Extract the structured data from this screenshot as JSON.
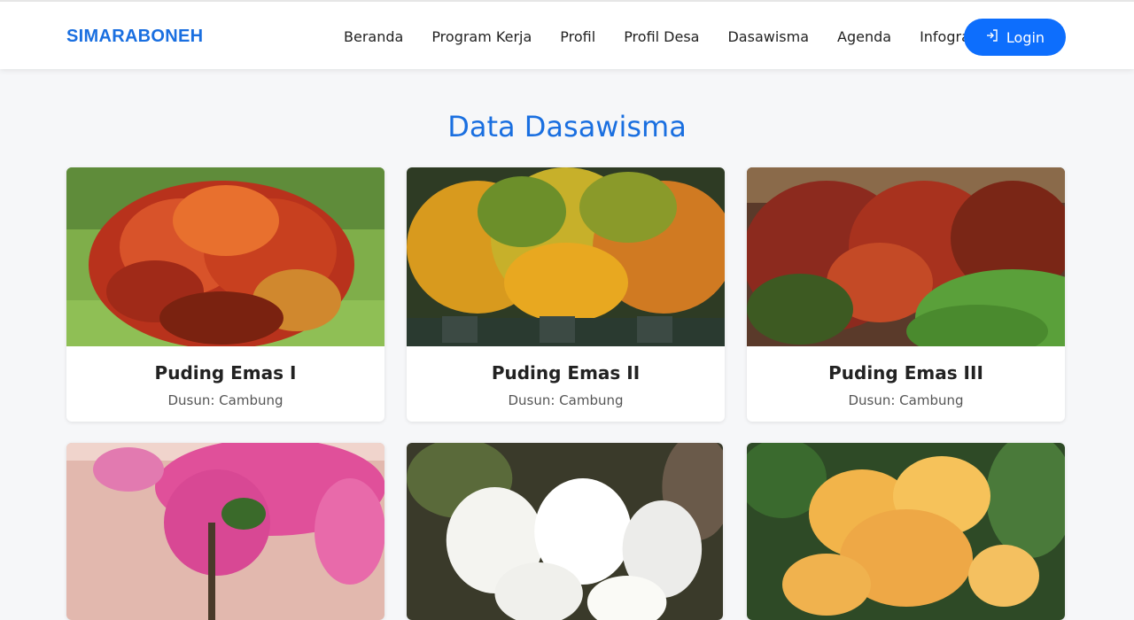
{
  "brand": "SIMARABONEH",
  "nav": [
    "Beranda",
    "Program Kerja",
    "Profil",
    "Profil Desa",
    "Dasawisma",
    "Agenda",
    "Infografis"
  ],
  "login_label": "Login",
  "section_title": "Data Dasawisma",
  "cards": [
    {
      "title": "Puding Emas I",
      "dusun": "Dusun: Cambung"
    },
    {
      "title": "Puding Emas II",
      "dusun": "Dusun: Cambung"
    },
    {
      "title": "Puding Emas III",
      "dusun": "Dusun: Cambung"
    }
  ]
}
